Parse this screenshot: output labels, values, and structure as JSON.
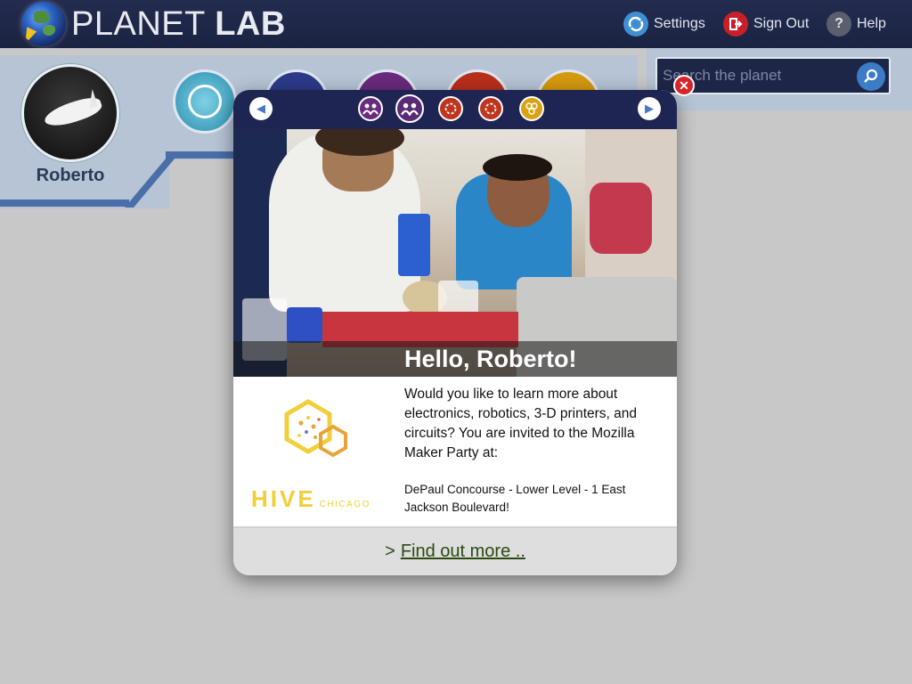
{
  "app": {
    "logo_light": "PLANET",
    "logo_bold": "LAB"
  },
  "topnav": {
    "settings": "Settings",
    "sign_out": "Sign Out",
    "help": "Help",
    "help_icon_glyph": "?"
  },
  "profile": {
    "username": "Roberto"
  },
  "search": {
    "placeholder": "Search the planet"
  },
  "popup": {
    "greeting": "Hello, Roberto!",
    "message": "Would you like to learn more about electronics, robotics, 3-D printers, and circuits?  You are invited to the Mozilla Maker Party at:",
    "address": "DePaul Concourse - Lower Level - 1 East Jackson Boulevard!",
    "hive_brand": "HIVE",
    "hive_city": "CHICAGO",
    "footer_prefix": ">",
    "footer_link": "Find out more .."
  },
  "colors": {
    "topbar": "#1f2748",
    "accent_blue": "#4a6ea8",
    "close_red": "#d8242b",
    "hive_yellow": "#f2cf3a",
    "hive_orange": "#e8a33a",
    "link_green": "#2b4a12"
  }
}
